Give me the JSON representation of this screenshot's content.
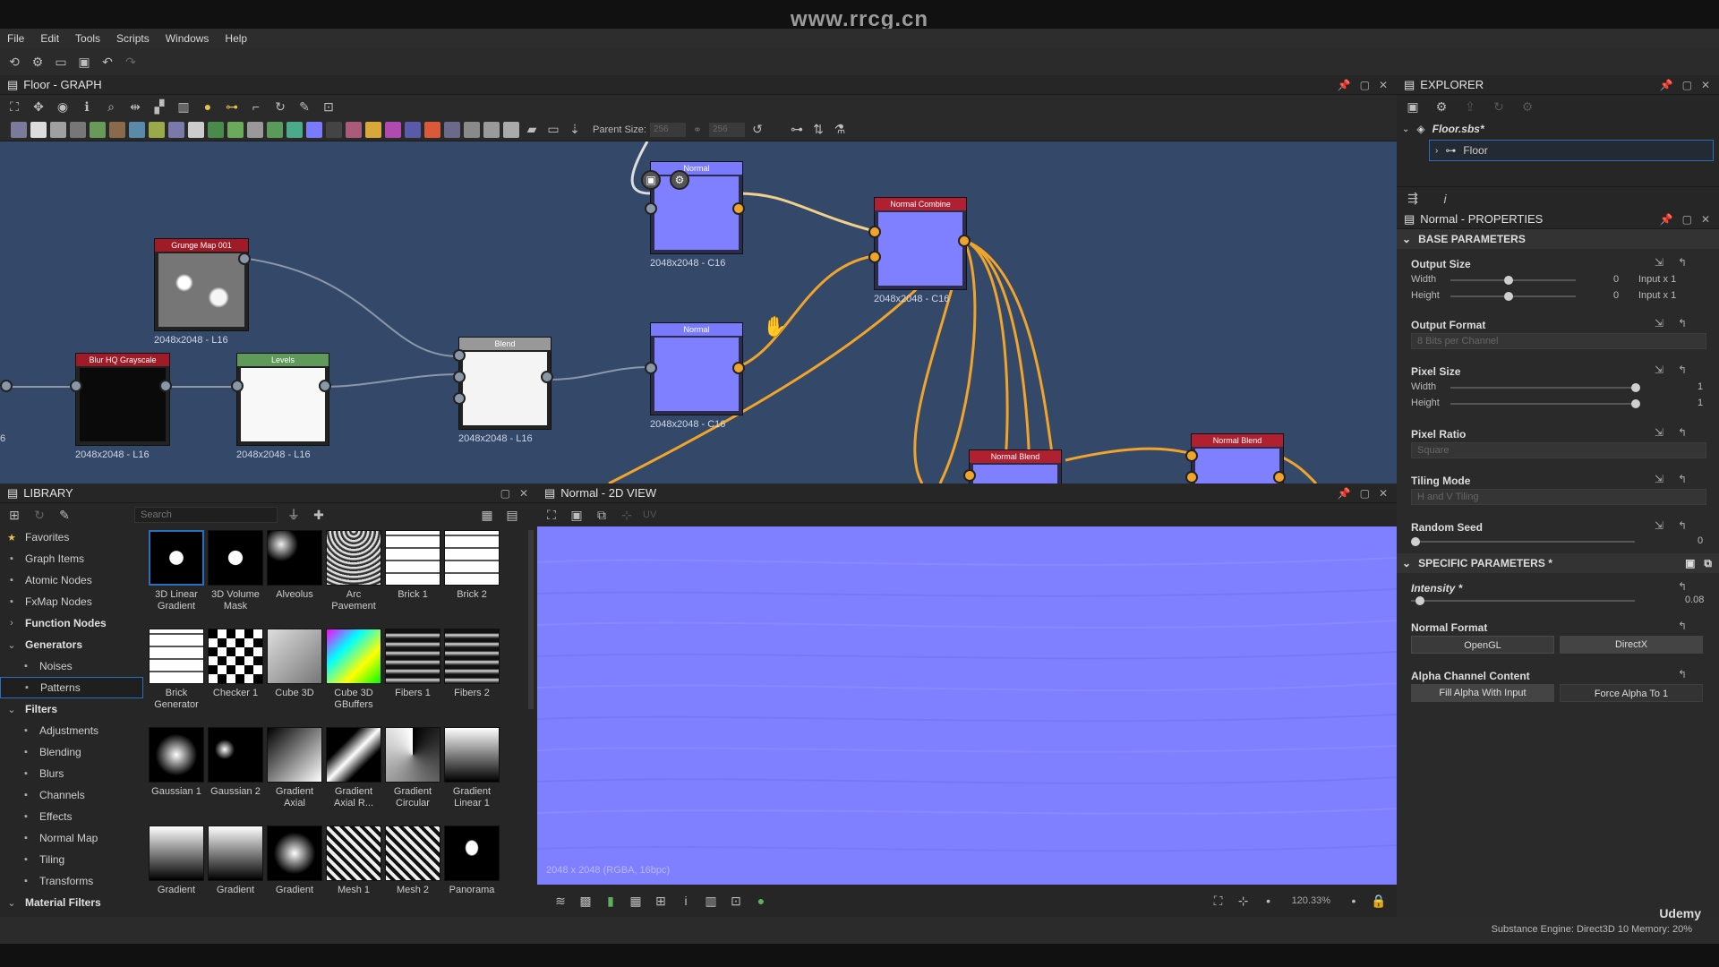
{
  "site_watermark": "www.rrcg.cn",
  "menu": [
    "File",
    "Edit",
    "Tools",
    "Scripts",
    "Windows",
    "Help"
  ],
  "graph": {
    "title": "Floor - GRAPH",
    "parent_size_label": "Parent Size:",
    "parent_size_a": "256",
    "parent_size_b": "256",
    "nodes": {
      "top_node": {
        "title": "Normal",
        "size": "2048x2048 - C16"
      },
      "normal_combine": {
        "title": "Normal Combine",
        "size": "2048x2048 - C16"
      },
      "grunge": {
        "title": "Grunge Map 001",
        "size": "2048x2048 - L16"
      },
      "blur": {
        "title": "Blur HQ Grayscale",
        "size": "2048x2048 - L16"
      },
      "levels": {
        "title": "Levels",
        "size": "2048x2048 - L16"
      },
      "blend": {
        "title": "Blend",
        "size": "2048x2048 - L16"
      },
      "normal": {
        "title": "Normal",
        "size": "2048x2048 - C16"
      },
      "normal_blend_1": {
        "title": "Normal Blend"
      },
      "normal_blend_2": {
        "title": "Normal Blend"
      },
      "left_stub": {
        "size": "6"
      }
    }
  },
  "explorer": {
    "title": "EXPLORER",
    "file": "Floor.sbs*",
    "graph_item": "Floor"
  },
  "properties": {
    "title": "Normal - PROPERTIES",
    "base_section": "BASE PARAMETERS",
    "output_size": {
      "label": "Output Size",
      "width_label": "Width",
      "height_label": "Height",
      "width_value": "0",
      "height_value": "0",
      "width_mode": "Input x 1",
      "height_mode": "Input x 1"
    },
    "output_format": {
      "label": "Output Format",
      "value": "8 Bits per Channel"
    },
    "pixel_size": {
      "label": "Pixel Size",
      "width_label": "Width",
      "height_label": "Height",
      "width_value": "1",
      "height_value": "1"
    },
    "pixel_ratio": {
      "label": "Pixel Ratio",
      "value": "Square"
    },
    "tiling_mode": {
      "label": "Tiling Mode",
      "value": "H and V Tiling"
    },
    "random_seed": {
      "label": "Random Seed",
      "value": "0"
    },
    "specific_section": "SPECIFIC PARAMETERS *",
    "intensity": {
      "label": "Intensity *",
      "value": "0.08",
      "fraction": 0.02
    },
    "normal_format": {
      "label": "Normal Format",
      "opt1": "OpenGL",
      "opt2": "DirectX"
    },
    "alpha_channel": {
      "label": "Alpha Channel Content",
      "opt1": "Fill Alpha With Input",
      "opt2": "Force Alpha To 1"
    }
  },
  "library": {
    "title": "LIBRARY",
    "search_placeholder": "Search",
    "tree": [
      {
        "label": "Favorites",
        "icon": "star-icon",
        "bold": false
      },
      {
        "label": "Graph Items",
        "icon": "graph-icon",
        "bold": false
      },
      {
        "label": "Atomic Nodes",
        "icon": "atom-icon",
        "bold": false
      },
      {
        "label": "FxMap Nodes",
        "icon": "fxmap-icon",
        "bold": false
      },
      {
        "label": "Function Nodes",
        "icon": "chevron-right-icon",
        "bold": true
      },
      {
        "label": "Generators",
        "icon": "chevron-down-icon",
        "bold": true
      },
      {
        "label": "Noises",
        "icon": "noise-icon",
        "bold": false,
        "indent": true
      },
      {
        "label": "Patterns",
        "icon": "pattern-icon",
        "bold": false,
        "indent": true,
        "selected": true
      },
      {
        "label": "Filters",
        "icon": "chevron-down-icon",
        "bold": true
      },
      {
        "label": "Adjustments",
        "icon": "adjust-icon",
        "bold": false,
        "indent": true
      },
      {
        "label": "Blending",
        "icon": "blend-icon",
        "bold": false,
        "indent": true
      },
      {
        "label": "Blurs",
        "icon": "blur-icon",
        "bold": false,
        "indent": true
      },
      {
        "label": "Channels",
        "icon": "channels-icon",
        "bold": false,
        "indent": true
      },
      {
        "label": "Effects",
        "icon": "effects-icon",
        "bold": false,
        "indent": true
      },
      {
        "label": "Normal Map",
        "icon": "normalmap-icon",
        "bold": false,
        "indent": true
      },
      {
        "label": "Tiling",
        "icon": "tiling-icon",
        "bold": false,
        "indent": true
      },
      {
        "label": "Transforms",
        "icon": "transform-icon",
        "bold": false,
        "indent": true
      },
      {
        "label": "Material Filters",
        "icon": "chevron-down-icon",
        "bold": true
      }
    ],
    "items": [
      {
        "label": "3D Linear Gradient",
        "style": "cube3d"
      },
      {
        "label": "3D Volume Mask",
        "style": "cube3d"
      },
      {
        "label": "Alveolus",
        "style": "alveolus"
      },
      {
        "label": "Arc Pavement",
        "style": "arc"
      },
      {
        "label": "Brick 1",
        "style": "brick"
      },
      {
        "label": "Brick 2",
        "style": "brick"
      },
      {
        "label": "Brick Generator",
        "style": "brick"
      },
      {
        "label": "Checker 1",
        "style": "checker"
      },
      {
        "label": "Cube 3D",
        "style": "cube"
      },
      {
        "label": "Cube 3D GBuffers",
        "style": "color"
      },
      {
        "label": "Fibers 1",
        "style": "fibers"
      },
      {
        "label": "Fibers 2",
        "style": "fibers"
      },
      {
        "label": "Gaussian 1",
        "style": "gauss1"
      },
      {
        "label": "Gaussian 2",
        "style": "gauss2"
      },
      {
        "label": "Gradient Axial",
        "style": "grad"
      },
      {
        "label": "Gradient Axial R...",
        "style": "grad2"
      },
      {
        "label": "Gradient Circular",
        "style": "gradc"
      },
      {
        "label": "Gradient Linear 1",
        "style": "gradl"
      },
      {
        "label": "Gradient",
        "style": "gradl"
      },
      {
        "label": "Gradient",
        "style": "gradl"
      },
      {
        "label": "Gradient",
        "style": "gauss1"
      },
      {
        "label": "Mesh 1",
        "style": "mesh"
      },
      {
        "label": "Mesh 2",
        "style": "mesh"
      },
      {
        "label": "Panorama",
        "style": "pano"
      }
    ]
  },
  "view2d": {
    "title": "Normal - 2D VIEW",
    "uv_label": "UV",
    "info": "2048 x 2048 (RGBA, 16bpc)",
    "zoom": "120.33%",
    "normal_color": "#7f80ff"
  },
  "status": {
    "engine": "Substance Engine: Direct3D 10",
    "memory": "Memory: 20%",
    "brand": "Udemy"
  }
}
